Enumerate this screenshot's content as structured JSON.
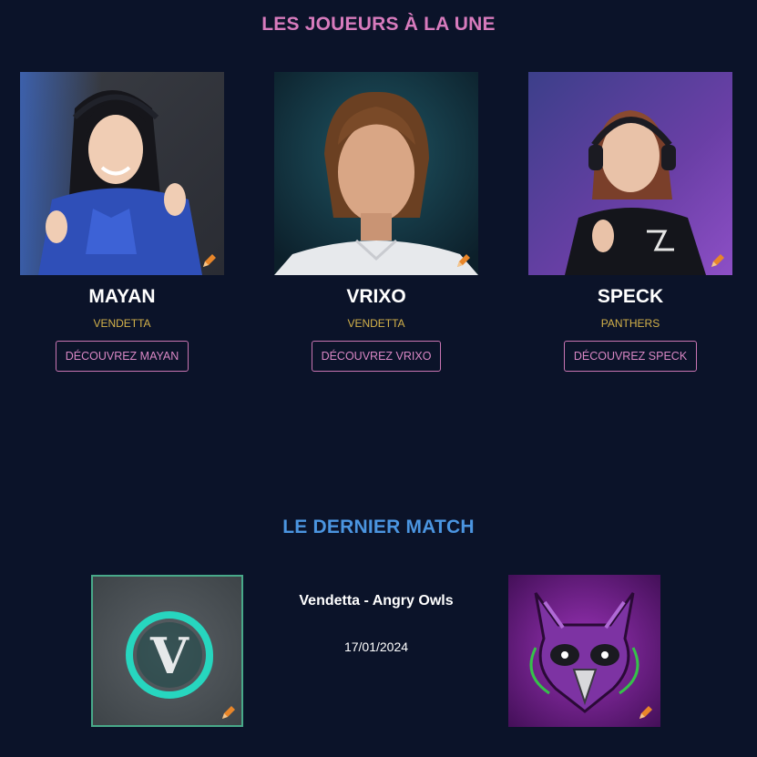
{
  "featured": {
    "title": "LES JOUEURS À LA UNE",
    "players": [
      {
        "name": "MAYAN",
        "team": "VENDETTA",
        "button": "DÉCOUVREZ MAYAN"
      },
      {
        "name": "VRIXO",
        "team": "VENDETTA",
        "button": "DÉCOUVREZ VRIXO"
      },
      {
        "name": "SPECK",
        "team": "PANTHERS",
        "button": "DÉCOUVREZ SPECK"
      }
    ]
  },
  "last_match": {
    "title": "LE DERNIER MATCH",
    "teams": "Vendetta - Angry Owls",
    "date": "17/01/2024",
    "home_logo_letter": "V"
  },
  "icons": [
    "edit-pencil-icon"
  ],
  "colors": {
    "background": "#0b1329",
    "players_title": "#d77bbd",
    "match_title": "#4b95e0",
    "team_label": "#d4b24a",
    "button_border": "#c975b3"
  }
}
